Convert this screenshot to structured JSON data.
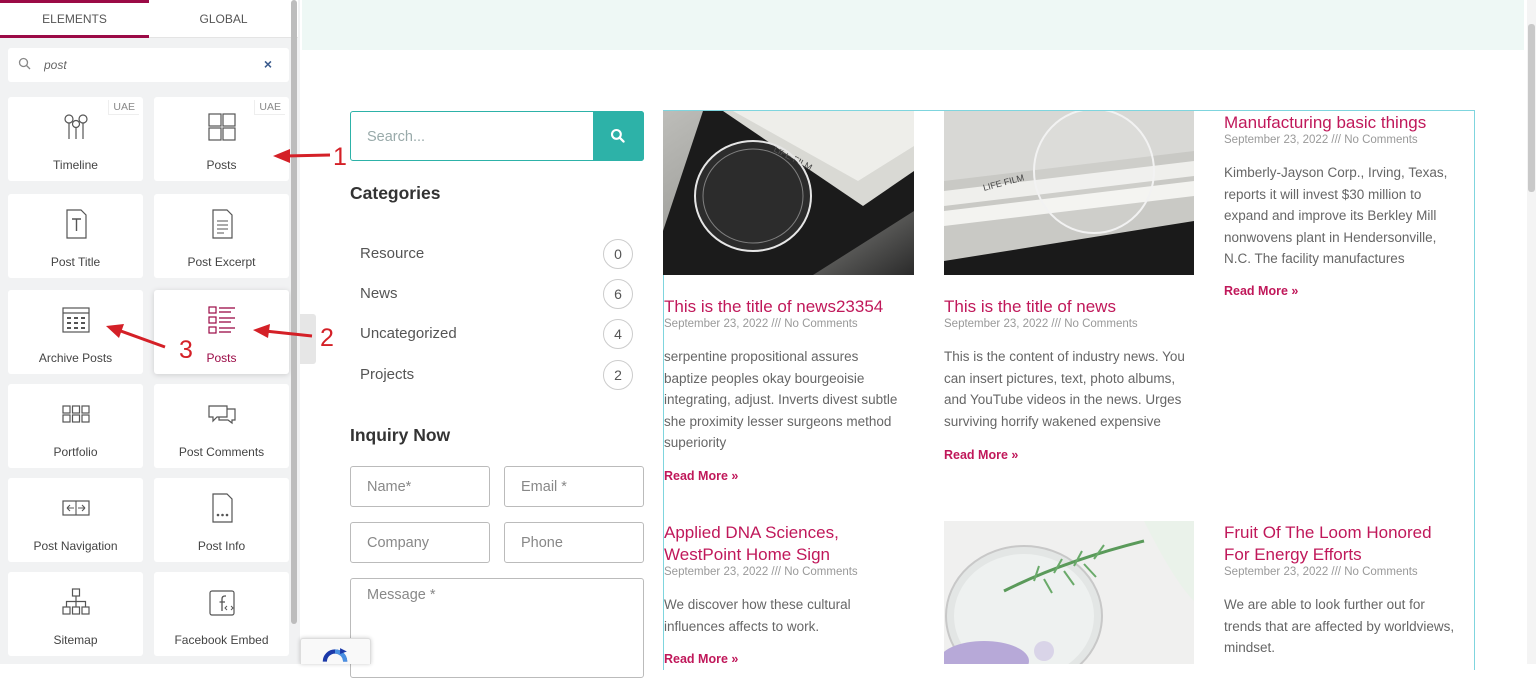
{
  "panel": {
    "tabs": [
      "ELEMENTS",
      "GLOBAL"
    ],
    "search_value": "post",
    "elements": [
      {
        "label": "Timeline",
        "badge": "UAE",
        "icon": "timeline-icon"
      },
      {
        "label": "Posts",
        "badge": "UAE",
        "icon": "posts-grid-icon"
      },
      {
        "label": "Post Title",
        "badge": "",
        "icon": "post-title-icon"
      },
      {
        "label": "Post Excerpt",
        "badge": "",
        "icon": "post-excerpt-icon"
      },
      {
        "label": "Archive Posts",
        "badge": "",
        "icon": "archive-posts-icon"
      },
      {
        "label": "Posts",
        "badge": "",
        "icon": "posts-list-icon"
      },
      {
        "label": "Portfolio",
        "badge": "",
        "icon": "portfolio-icon"
      },
      {
        "label": "Post Comments",
        "badge": "",
        "icon": "post-comments-icon"
      },
      {
        "label": "Post Navigation",
        "badge": "",
        "icon": "post-navigation-icon"
      },
      {
        "label": "Post Info",
        "badge": "",
        "icon": "post-info-icon"
      },
      {
        "label": "Sitemap",
        "badge": "",
        "icon": "sitemap-icon"
      },
      {
        "label": "Facebook Embed",
        "badge": "",
        "icon": "facebook-embed-icon"
      }
    ]
  },
  "annotations": [
    "1",
    "2",
    "3"
  ],
  "sidebar": {
    "search_placeholder": "Search...",
    "categories_title": "Categories",
    "categories": [
      {
        "name": "Resource",
        "count": "0"
      },
      {
        "name": "News",
        "count": "6"
      },
      {
        "name": "Uncategorized",
        "count": "4"
      },
      {
        "name": "Projects",
        "count": "2"
      }
    ],
    "inquiry_title": "Inquiry Now",
    "fields": {
      "name": "Name*",
      "email": "Email *",
      "company": "Company",
      "phone": "Phone",
      "message": "Message *"
    }
  },
  "posts": [
    {
      "title": "This is the title of news23354",
      "meta": "September 23, 2022 /// No Comments",
      "excerpt": [
        "serpentine propositional assures",
        "baptize peoples okay bourgeoisie",
        "integrating, adjust. Inverts divest subtle",
        "she proximity lesser surgeons method",
        "superiority"
      ],
      "more": "Read More »"
    },
    {
      "title": "This is the title of news",
      "meta": "September 23, 2022 /// No Comments",
      "excerpt": [
        "This is the content of industry news. You",
        "can insert pictures, text, photo albums,",
        "and YouTube videos in the news. Urges",
        "surviving horrify wakened expensive"
      ],
      "more": "Read More »"
    },
    {
      "title": "Manufacturing basic things",
      "meta": "September 23, 2022 /// No Comments",
      "excerpt": [
        "Kimberly-Jayson Corp., Irving, Texas,",
        "reports it will invest $30 million to",
        "expand and improve its Berkley Mill",
        "nonwovens plant in Hendersonville,",
        "N.C. The facility manufactures"
      ],
      "more": "Read More »"
    },
    {
      "title": "Applied DNA Sciences, WestPoint Home Sign",
      "title_lines": [
        "Applied DNA Sciences,",
        "WestPoint Home Sign"
      ],
      "meta": "September 23, 2022 /// No Comments",
      "excerpt": [
        "We discover how these cultural",
        "influences affects to work."
      ],
      "more": "Read More »"
    },
    {
      "title": "Fruit Of The Loom Honored For Energy Efforts",
      "title_lines": [
        "Fruit Of The Loom Honored",
        "For Energy Efforts"
      ],
      "meta": "September 23, 2022 /// No Comments",
      "excerpt": [
        "We are able to look further out for",
        "trends that are affected by worldviews,",
        "mindset."
      ],
      "more": ""
    }
  ],
  "image_text": "LIFE FILM",
  "colors": {
    "accent": "#c0185a",
    "teal": "#2db2a8",
    "panel_accent": "#9b0a46",
    "annotation": "#d42027"
  }
}
